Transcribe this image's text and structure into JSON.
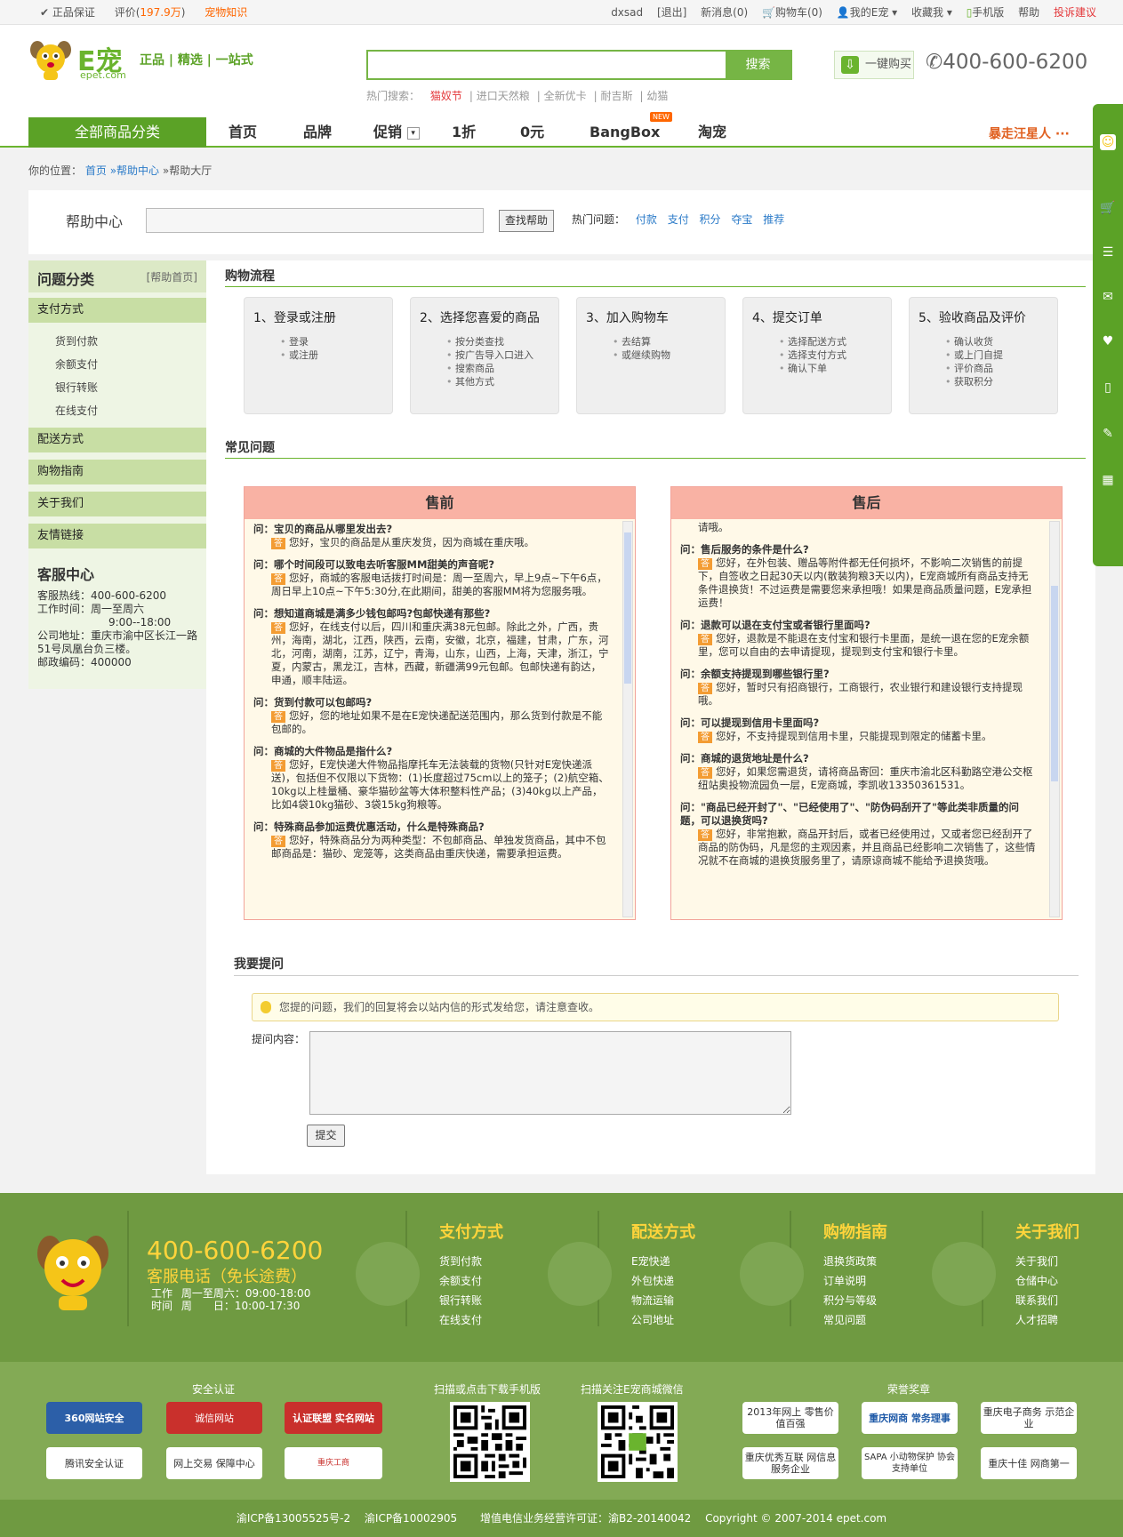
{
  "topbar": {
    "guarantee": "正品保证",
    "rating_label": "评价(",
    "rating_count": "197.9万",
    "rating_close": ")",
    "knowledge": "宠物知识",
    "username": "dxsad",
    "logout": "[退出]",
    "messages": "新消息(0)",
    "cart": "购物车(0)",
    "my_epet": "我的E宠",
    "favorites": "收藏我",
    "mobile": "手机版",
    "help": "帮助",
    "complaint": "投诉建议"
  },
  "header": {
    "logo_text": "E宠",
    "logo_domain": "epet.com",
    "slogan": "正品 | 精选 | 一站式",
    "search_button": "搜索",
    "hot_label": "热门搜索：",
    "hot_items": [
      "猫奴节",
      "进口天然粮",
      "全新优卡",
      "耐吉斯",
      "幼猫"
    ],
    "one_click": "一键购买",
    "phone": "400-600-6200"
  },
  "nav": {
    "all_categories": "全部商品分类",
    "items": [
      "首页",
      "品牌",
      "促销",
      "1折",
      "0元",
      "BangBox",
      "淘宠"
    ],
    "new_badge": "NEW",
    "promo": "暴走汪星人 ···"
  },
  "breadcrumb": {
    "label": "你的位置：",
    "home": "首页",
    "center": "»帮助中心",
    "current": "»帮助大厅"
  },
  "help_search": {
    "title": "帮助中心",
    "button": "查找帮助",
    "hot_label": "热门问题：",
    "hot_links": [
      "付款",
      "支付",
      "积分",
      "夺宝",
      "推荐"
    ]
  },
  "sidebar": {
    "title": "问题分类",
    "home_link": "[帮助首页]",
    "categories": [
      {
        "label": "支付方式",
        "items": [
          "货到付款",
          "余额支付",
          "银行转账",
          "在线支付"
        ]
      },
      {
        "label": "配送方式",
        "items": []
      },
      {
        "label": "购物指南",
        "items": []
      },
      {
        "label": "关于我们",
        "items": []
      },
      {
        "label": "友情链接",
        "items": []
      }
    ],
    "service_title": "客服中心",
    "service_lines": [
      "客服热线：400-600-6200",
      "工作时间：周一至周六",
      "9:00--18:00",
      "公司地址：重庆市渝中区长江一路",
      "51号凤凰台负三楼。",
      "邮政编码：400000"
    ]
  },
  "process": {
    "title": "购物流程",
    "steps": [
      {
        "title": "1、登录或注册",
        "items": [
          "登录",
          "或注册"
        ]
      },
      {
        "title": "2、选择您喜爱的商品",
        "items": [
          "按分类查找",
          "按广告导入口进入",
          "搜索商品",
          "其他方式"
        ]
      },
      {
        "title": "3、加入购物车",
        "items": [
          "去结算",
          "或继续购物"
        ]
      },
      {
        "title": "4、提交订单",
        "items": [
          "选择配送方式",
          "选择支付方式",
          "确认下单"
        ]
      },
      {
        "title": "5、验收商品及评价",
        "items": [
          "确认收货",
          "或上门自提",
          "评价商品",
          "获取积分"
        ]
      }
    ]
  },
  "faq": {
    "title": "常见问题",
    "answer_tag": "答",
    "presale": {
      "title": "售前",
      "qa": [
        {
          "q": "问：宝贝的商品从哪里发出去?",
          "a": "您好，宝贝的商品是从重庆发货，因为商城在重庆哦。"
        },
        {
          "q": "问：哪个时间段可以致电去听客服MM甜美的声音呢?",
          "a": "您好，商城的客服电话拨打时间是：周一至周六，早上9点~下午6点，周日早上10点~下午5:30分,在此期间，甜美的客服MM将为您服务哦。"
        },
        {
          "q": "问：想知道商城是满多少钱包邮吗?包邮快递有那些?",
          "a": "您好，在线支付以后，四川和重庆满38元包邮。除此之外，广西，贵州，海南，湖北，江西，陕西，云南，安徽，北京，福建，甘肃，广东，河北，河南，湖南，江苏，辽宁，青海，山东，山西，上海，天津，浙江，宁夏，内蒙古，黑龙江，吉林，西藏，新疆满99元包邮。包邮快递有韵达，申通，顺丰陆运。"
        },
        {
          "q": "问：货到付款可以包邮吗?",
          "a": "您好，您的地址如果不是在E宠快递配送范围内，那么货到付款是不能包邮的。"
        },
        {
          "q": "问：商城的大件物品是指什么?",
          "a": "您好，E宠快递大件物品指摩托车无法装载的货物(只针对E宠快递派送)，包括但不仅限以下货物：(1)长度超过75cm以上的笼子；(2)航空箱、10kg以上桂量桶、豪华猫砂盆等大体积整料性产品；(3)40kg以上产品，比如4袋10kg猫砂、3袋15kg狗粮等。"
        },
        {
          "q": "问：特殊商品参加运费优惠活动，什么是特殊商品?",
          "a": "您好，特殊商品分为两种类型：不包邮商品、单独发货商品，其中不包邮商品是：猫砂、宠笼等，这类商品由重庆快递，需要承担运费。"
        }
      ]
    },
    "aftersale": {
      "title": "售后",
      "lead": "请哦。",
      "qa": [
        {
          "q": "问：售后服务的条件是什么?",
          "a": "您好，在外包装、赠品等附件都无任何损坏，不影响二次销售的前提下，自签收之日起30天以内(散装狗粮3天以内)，E宠商城所有商品支持无条件退换货！不过运费是需要您来承担哦！如果是商品质量问题，E宠承担运费！"
        },
        {
          "q": "问：退款可以退在支付宝或者银行里面吗?",
          "a": "您好，退款是不能退在支付宝和银行卡里面，是统一退在您的E宠余额里，您可以自由的去申请提现，提现到支付宝和银行卡里。"
        },
        {
          "q": "问：余额支持提现到哪些银行里?",
          "a": "您好，暂时只有招商银行，工商银行，农业银行和建设银行支持提现哦。"
        },
        {
          "q": "问：可以提现到信用卡里面吗?",
          "a": "您好，不支持提现到信用卡里，只能提现到限定的储蓄卡里。"
        },
        {
          "q": "问：商城的退货地址是什么?",
          "a": "您好，如果您需退货，请将商品寄回：重庆市渝北区科勤路空港公交枢纽站奥投物流园负一层，E宠商城，李凯收13350361531。"
        },
        {
          "q": "问：\"商品已经开封了\"、\"已经使用了\"、\"防伪码刮开了\"等此类非质量的问题，可以退换货吗?",
          "a": "您好，非常抱歉，商品开封后，或者已经使用过，又或者您已经刮开了商品的防伪码，凡是您的主观因素，并且商品已经影响二次销售了，这些情况就不在商城的退换货服务里了，请原谅商城不能给予退换货哦。"
        }
      ]
    }
  },
  "ask": {
    "title": "我要提问",
    "tip": "您提的问题，我们的回复将会以站内信的形式发给您，请注意查收。",
    "content_label": "提问内容：",
    "submit": "提交"
  },
  "footer": {
    "phone": "400-600-6200",
    "service": "客服电话（免长途费）",
    "hours_label": "工作时间",
    "hours": [
      "周一至周六：09:00-18:00",
      "周　　日：10:00-17:30"
    ],
    "columns": [
      {
        "title": "支付方式",
        "links": [
          "货到付款",
          "余额支付",
          "银行转账",
          "在线支付"
        ]
      },
      {
        "title": "配送方式",
        "links": [
          "E宠快递",
          "外包快递",
          "物流运输",
          "公司地址"
        ]
      },
      {
        "title": "购物指南",
        "links": [
          "退换货政策",
          "订单说明",
          "积分与等级",
          "常见问题"
        ]
      },
      {
        "title": "关于我们",
        "links": [
          "关于我们",
          "仓储中心",
          "联系我们",
          "人才招聘"
        ]
      }
    ],
    "security_title": "安全认证",
    "security_badges": [
      "360网站安全",
      "诚信网站",
      "认证联盟 实名网站",
      "腾讯安全认证",
      "网上交易 保障中心",
      "重庆工商"
    ],
    "app_title": "扫描或点击下载手机版",
    "wechat_title": "扫描关注E宠商城微信",
    "honor_title": "荣誉奖章",
    "honor_badges": [
      "2013年网上 零售价值百强",
      "重庆网商 常务理事",
      "重庆电子商务 示范企业",
      "重庆优秀互联 网信息服务企业",
      "SAPA 小动物保护 协会支持单位",
      "重庆十佳 网商第一"
    ],
    "icp": [
      "渝ICP备13005525号-2",
      "渝ICP备10002905",
      "增值电信业务经营许可证：渝B2-20140042",
      "Copyright © 2007-2014 epet.com"
    ]
  },
  "colors": {
    "brand_green": "#6ab42e",
    "footer_green": "#6f9a41",
    "accent_orange": "#f60",
    "faq_header": "#f9b2a4",
    "answer_tag": "#f39c33"
  }
}
